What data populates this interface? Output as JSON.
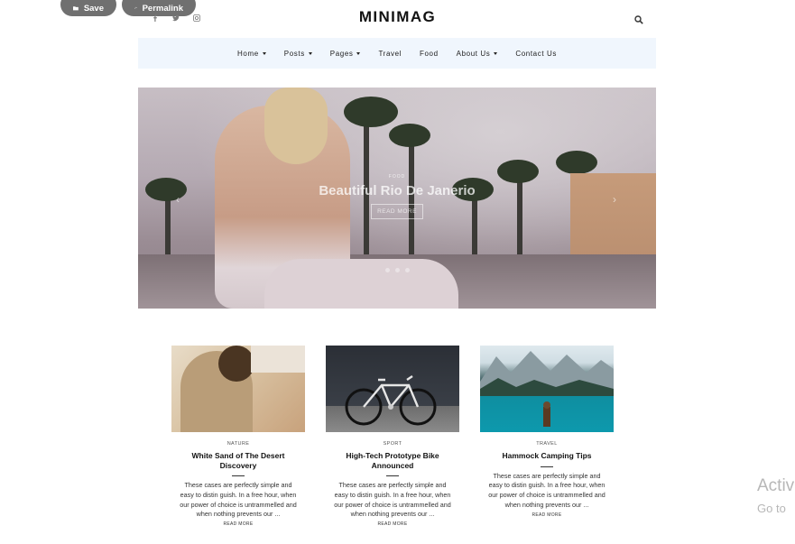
{
  "toolbar": {
    "save_label": "Save",
    "permalink_label": "Permalink"
  },
  "header": {
    "logo": "MINIMAG",
    "social_icons": [
      "facebook-icon",
      "twitter-icon",
      "instagram-icon"
    ],
    "search_icon": "search-icon"
  },
  "nav": {
    "items": [
      {
        "label": "Home",
        "dropdown": true
      },
      {
        "label": "Posts",
        "dropdown": true
      },
      {
        "label": "Pages",
        "dropdown": true
      },
      {
        "label": "Travel",
        "dropdown": false
      },
      {
        "label": "Food",
        "dropdown": false
      },
      {
        "label": "About Us",
        "dropdown": true
      },
      {
        "label": "Contact Us",
        "dropdown": false
      }
    ]
  },
  "hero": {
    "category": "FOOD",
    "title": "Beautiful Rio De Janerio",
    "button": "READ MORE",
    "prev_arrow": "‹",
    "next_arrow": "›"
  },
  "posts": [
    {
      "category": "NATURE",
      "title": "White Sand of The Desert Discovery",
      "excerpt": "These cases are perfectly simple and easy to distin guish. In a free hour, when our power of choice is untrammelled and when nothing prevents our ...",
      "more": "READ MORE"
    },
    {
      "category": "SPORT",
      "title": "High-Tech Prototype Bike Announced",
      "excerpt": "These cases are perfectly simple and easy to distin guish. In a free hour, when our power of choice is untrammelled and when nothing prevents our ...",
      "more": "READ MORE"
    },
    {
      "category": "TRAVEL",
      "title": "Hammock Camping Tips",
      "excerpt": "These cases are perfectly simple and easy to distin guish. In a free hour, when our power of choice is untrammelled and when nothing prevents our ...",
      "more": "READ MORE"
    }
  ],
  "watermark": {
    "line1": "Activ",
    "line2": "Go to"
  },
  "colors": {
    "nav_bg": "#f0f6fd",
    "pill_bg": "#707070"
  }
}
